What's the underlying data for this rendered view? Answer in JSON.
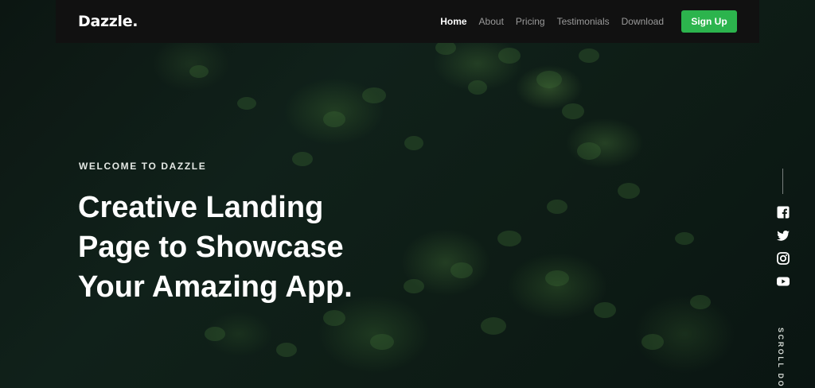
{
  "navbar": {
    "brand": "Dazzle.",
    "links": [
      {
        "label": "Home",
        "active": true
      },
      {
        "label": "About",
        "active": false
      },
      {
        "label": "Pricing",
        "active": false
      },
      {
        "label": "Testimonials",
        "active": false
      },
      {
        "label": "Download",
        "active": false
      }
    ],
    "cta_label": "Sign Up"
  },
  "hero": {
    "eyebrow": "WELCOME TO DAZZLE",
    "headline_lines": [
      "Creative Landing",
      "Page to Showcase",
      "Your Amazing App."
    ]
  },
  "social": {
    "icons": [
      "facebook-icon",
      "twitter-icon",
      "instagram-icon",
      "youtube-icon"
    ]
  },
  "scroll_label": "SCROLL DO",
  "colors": {
    "accent": "#2cb44d",
    "navbar_bg": "#111111",
    "text_primary": "#ffffff",
    "text_muted": "#9a9a9a",
    "background": "#0b1410"
  }
}
